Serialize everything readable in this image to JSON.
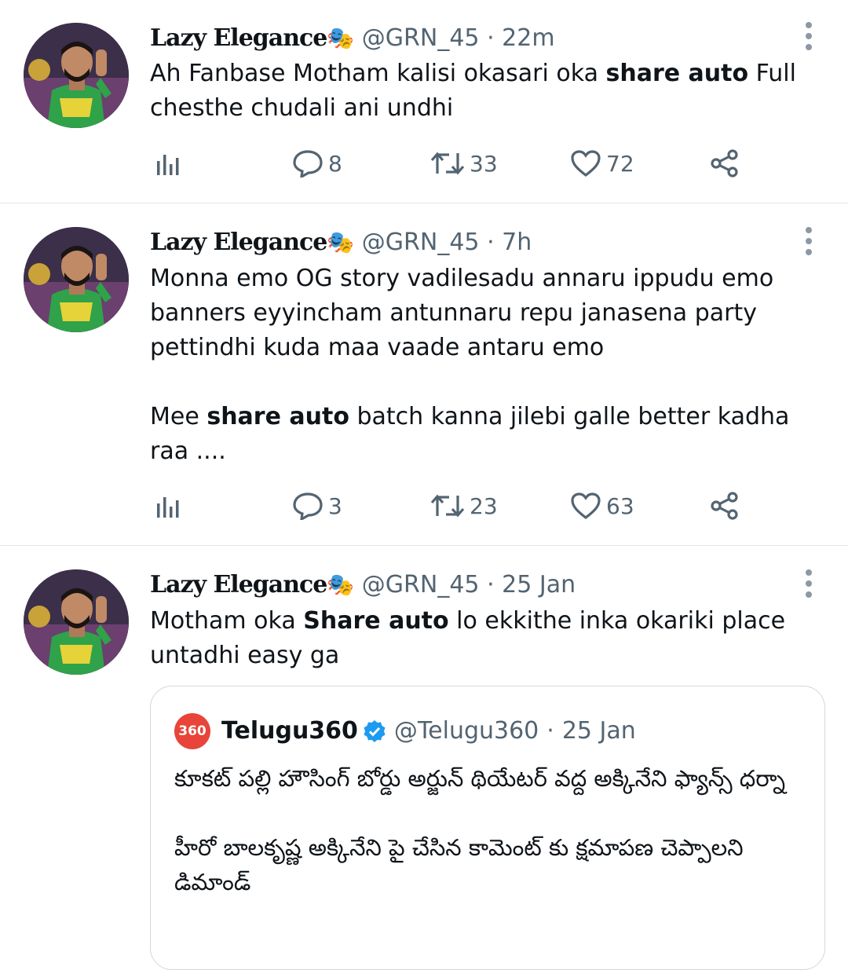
{
  "tweets": [
    {
      "name": "Lazy Elegance",
      "emoji": "🎭",
      "handle": "@GRN_45",
      "dot": "·",
      "time": "22m",
      "text_pre": "Ah Fanbase Motham kalisi okasari oka ",
      "text_bold": "share auto",
      "text_post": " Full chesthe chudali ani undhi",
      "replies": "8",
      "retweets": "33",
      "likes": "72"
    },
    {
      "name": "Lazy Elegance",
      "emoji": "🎭",
      "handle": "@GRN_45",
      "dot": "·",
      "time": "7h",
      "line1": "Monna emo OG story vadilesadu annaru ippudu emo banners eyyincham antunnaru repu janasena party pettindhi kuda maa vaade  antaru emo",
      "line2_pre": "Mee ",
      "line2_bold": "share auto",
      "line2_post": " batch kanna jilebi galle better kadha raa ....",
      "replies": "3",
      "retweets": "23",
      "likes": "63"
    },
    {
      "name": "Lazy Elegance",
      "emoji": "🎭",
      "handle": "@GRN_45",
      "dot": "·",
      "time": "25 Jan",
      "text_pre": "Motham oka ",
      "text_bold": "Share auto",
      "text_post": " lo ekkithe inka okariki place untadhi easy ga"
    }
  ],
  "quoted": {
    "logo": "360",
    "name": "Telugu360",
    "handle": "@Telugu360",
    "dot": "·",
    "time": "25 Jan",
    "para1": "కూకట్ పల్లి హౌసింగ్ బోర్డు అర్జున్ థియేటర్ వద్ద అక్కినేని ఫ్యాన్స్ ధర్నా",
    "para2": "హీరో బాలకృష్ణ అక్కినేని పై చేసిన కామెంట్ కు  క్షమాపణ చెప్పాలని డిమాండ్"
  },
  "icons": {
    "analytics": "analytics-icon",
    "reply": "reply-icon",
    "retweet": "retweet-icon",
    "like": "like-icon",
    "share": "share-icon",
    "more": "more-icon",
    "verified": "verified-badge-icon"
  },
  "colors": {
    "text": "#0f1419",
    "secondary": "#536471",
    "verified": "#1d9bf0",
    "logo": "#e8443a"
  }
}
